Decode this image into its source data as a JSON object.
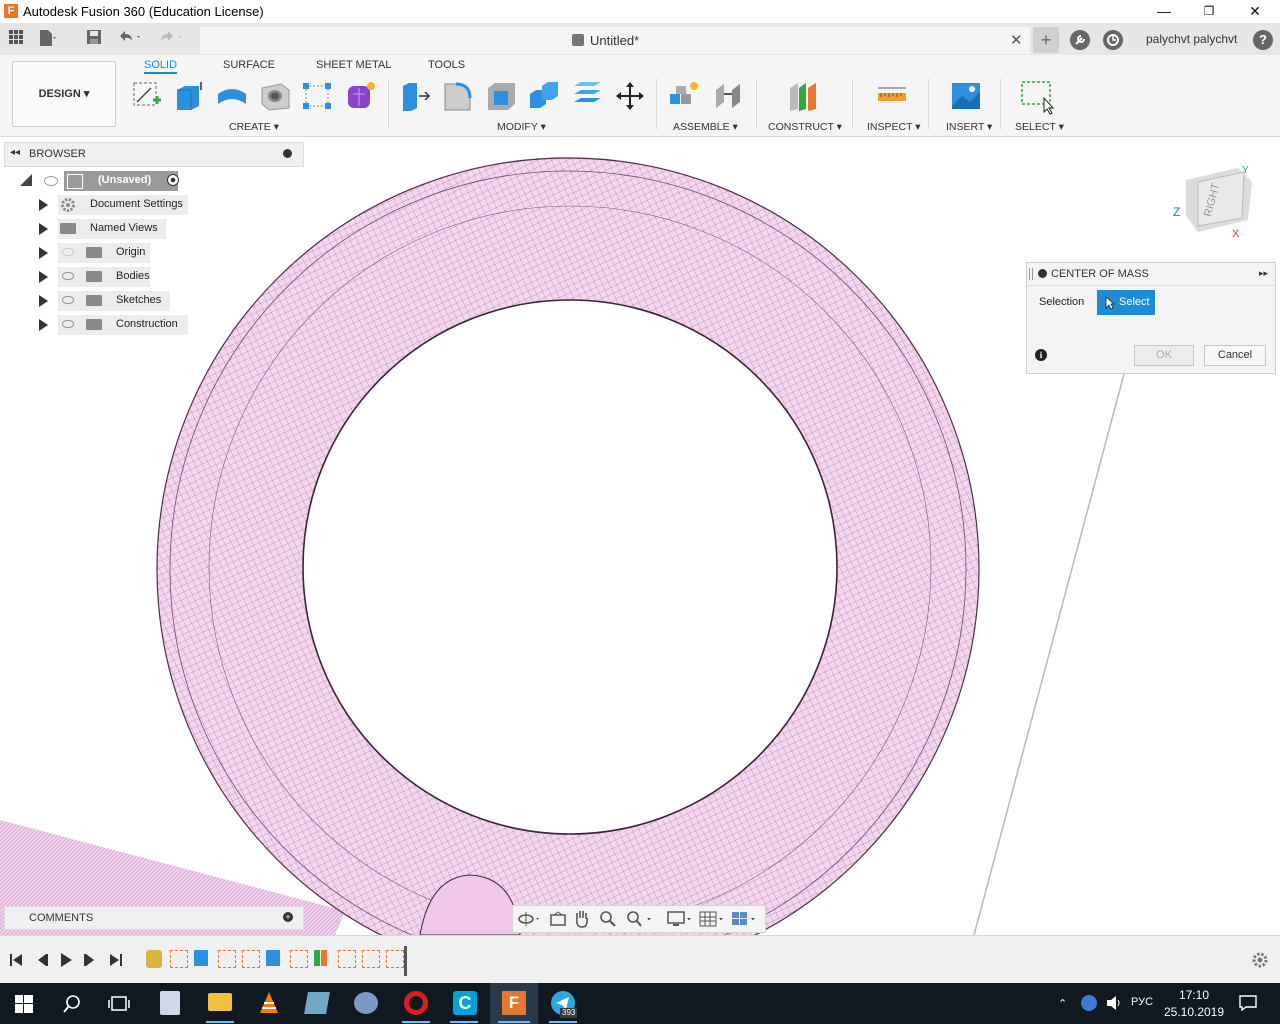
{
  "window": {
    "title": "Autodesk Fusion 360 (Education License)",
    "app_icon_letter": "F",
    "minimize": "—",
    "restore": "❐",
    "close": "✕"
  },
  "tabbar": {
    "document_title": "Untitled*",
    "close_tab": "✕",
    "add_tab": "+",
    "username": "palychvt palychvt",
    "help": "?"
  },
  "toolbar": {
    "workspace": "DESIGN",
    "tabs": [
      "SOLID",
      "SURFACE",
      "SHEET METAL",
      "TOOLS"
    ],
    "active_tab": "SOLID",
    "groups": [
      "CREATE",
      "MODIFY",
      "ASSEMBLE",
      "CONSTRUCT",
      "INSPECT",
      "INSERT",
      "SELECT"
    ],
    "dropdown_glyph": "▾"
  },
  "browser": {
    "title": "BROWSER",
    "root": "(Unsaved)",
    "items": [
      {
        "label": "Document Settings",
        "icon": "gear-icon"
      },
      {
        "label": "Named Views",
        "icon": "folder-icon"
      },
      {
        "label": "Origin",
        "icon": "folder-icon"
      },
      {
        "label": "Bodies",
        "icon": "folder-icon"
      },
      {
        "label": "Sketches",
        "icon": "folder-icon"
      },
      {
        "label": "Construction",
        "icon": "folder-icon"
      }
    ]
  },
  "viewcube": {
    "face": "RIGHT",
    "axis_y": "Y",
    "axis_z": "Z",
    "axis_x": "X"
  },
  "dialog": {
    "title": "CENTER OF MASS",
    "selection_label": "Selection",
    "select_button": "Select",
    "ok": "OK",
    "cancel": "Cancel",
    "info": "i"
  },
  "comments": {
    "title": "COMMENTS"
  },
  "taskbar": {
    "language": "РУС",
    "time": "17:10",
    "date": "25.10.2019",
    "telegram_badge": "393"
  },
  "colors": {
    "accent": "#0696d7",
    "model_fill": "#f5d5f0",
    "select_button": "#1f8bd1",
    "taskbar": "#101820"
  }
}
